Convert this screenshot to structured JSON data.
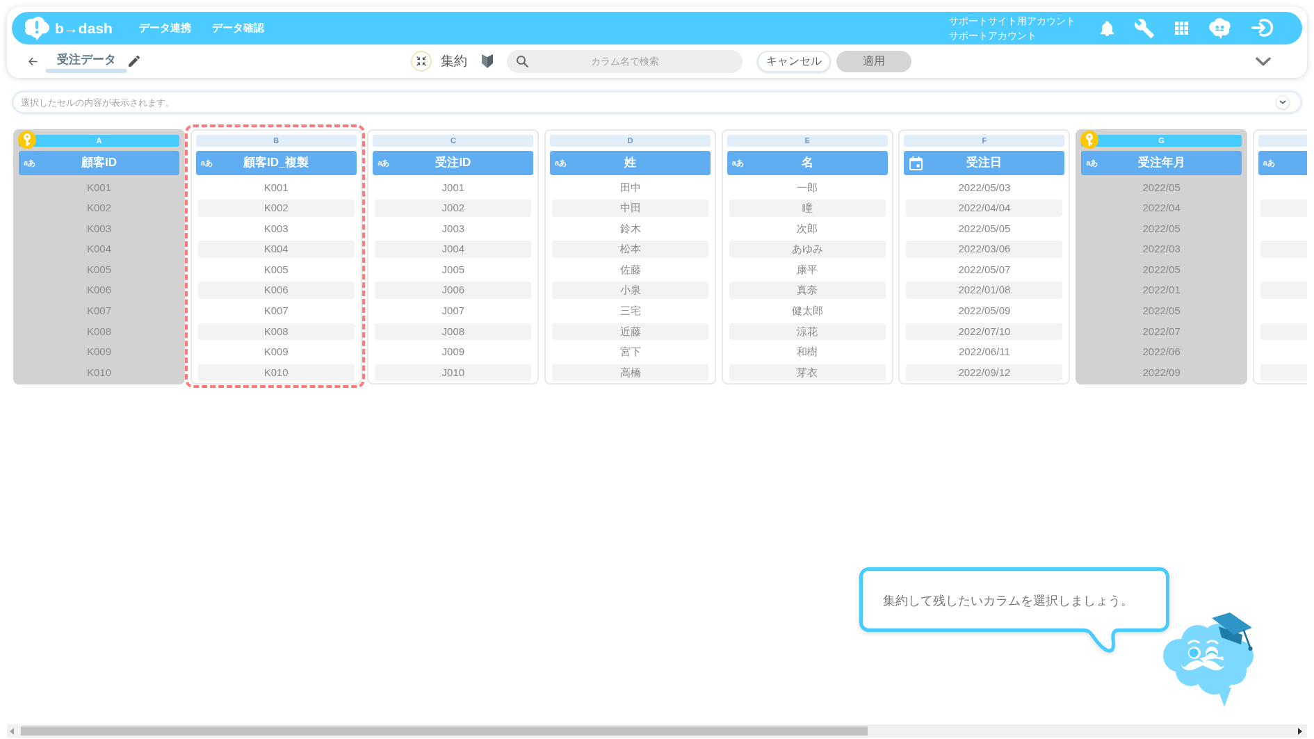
{
  "navbar": {
    "logo": "b→dash",
    "links": [
      {
        "label": "データ連携"
      },
      {
        "label": "データ確認"
      }
    ],
    "account": {
      "site": "サポートサイト用アカウント",
      "user": "サポートアカウント"
    }
  },
  "toolbar": {
    "title": "受注データ",
    "mode": "集約",
    "search": {
      "placeholder": "カラム名で検索"
    },
    "buttons": [
      {
        "label": "キャンセル",
        "disabled": false
      },
      {
        "label": "適用",
        "disabled": true
      }
    ]
  },
  "cell_viewer": {
    "placeholder": "選択したセルの内容が表示されます。"
  },
  "columns": [
    {
      "letter": "A",
      "kind": "text",
      "type_label": "aあ",
      "title": "顧客ID",
      "key": true,
      "highlighted": false,
      "values": [
        "K001",
        "K002",
        "K003",
        "K004",
        "K005",
        "K006",
        "K007",
        "K008",
        "K009",
        "K010"
      ]
    },
    {
      "letter": "B",
      "kind": "text",
      "type_label": "aあ",
      "title": "顧客ID_複製",
      "key": false,
      "highlighted": true,
      "values": [
        "K001",
        "K002",
        "K003",
        "K004",
        "K005",
        "K006",
        "K007",
        "K008",
        "K009",
        "K010"
      ]
    },
    {
      "letter": "C",
      "kind": "text",
      "type_label": "aあ",
      "title": "受注ID",
      "key": false,
      "highlighted": false,
      "values": [
        "J001",
        "J002",
        "J003",
        "J004",
        "J005",
        "J006",
        "J007",
        "J008",
        "J009",
        "J010"
      ]
    },
    {
      "letter": "D",
      "kind": "text",
      "type_label": "aあ",
      "title": "姓",
      "key": false,
      "highlighted": false,
      "values": [
        "田中",
        "中田",
        "鈴木",
        "松本",
        "佐藤",
        "小泉",
        "三宅",
        "近藤",
        "宮下",
        "高橋"
      ]
    },
    {
      "letter": "E",
      "kind": "text",
      "type_label": "aあ",
      "title": "名",
      "key": false,
      "highlighted": false,
      "values": [
        "一郎",
        "瞳",
        "次郎",
        "あゆみ",
        "康平",
        "真奈",
        "健太郎",
        "涼花",
        "和樹",
        "芽衣"
      ]
    },
    {
      "letter": "F",
      "kind": "date",
      "title": "受注日",
      "key": false,
      "highlighted": false,
      "values": [
        "2022/05/03",
        "2022/04/04",
        "2022/05/05",
        "2022/03/06",
        "2022/05/07",
        "2022/01/08",
        "2022/05/09",
        "2022/07/10",
        "2022/06/11",
        "2022/09/12"
      ]
    },
    {
      "letter": "G",
      "kind": "text",
      "type_label": "aあ",
      "title": "受注年月",
      "key": true,
      "highlighted": false,
      "values": [
        "2022/05",
        "2022/04",
        "2022/05",
        "2022/03",
        "2022/05",
        "2022/01",
        "2022/05",
        "2022/07",
        "2022/06",
        "2022/09"
      ]
    },
    {
      "kind": "text",
      "type_label": "aあ",
      "key": false,
      "highlighted": false
    }
  ],
  "tutorial": {
    "message": "集約して残したいカラムを選択しましょう。"
  }
}
